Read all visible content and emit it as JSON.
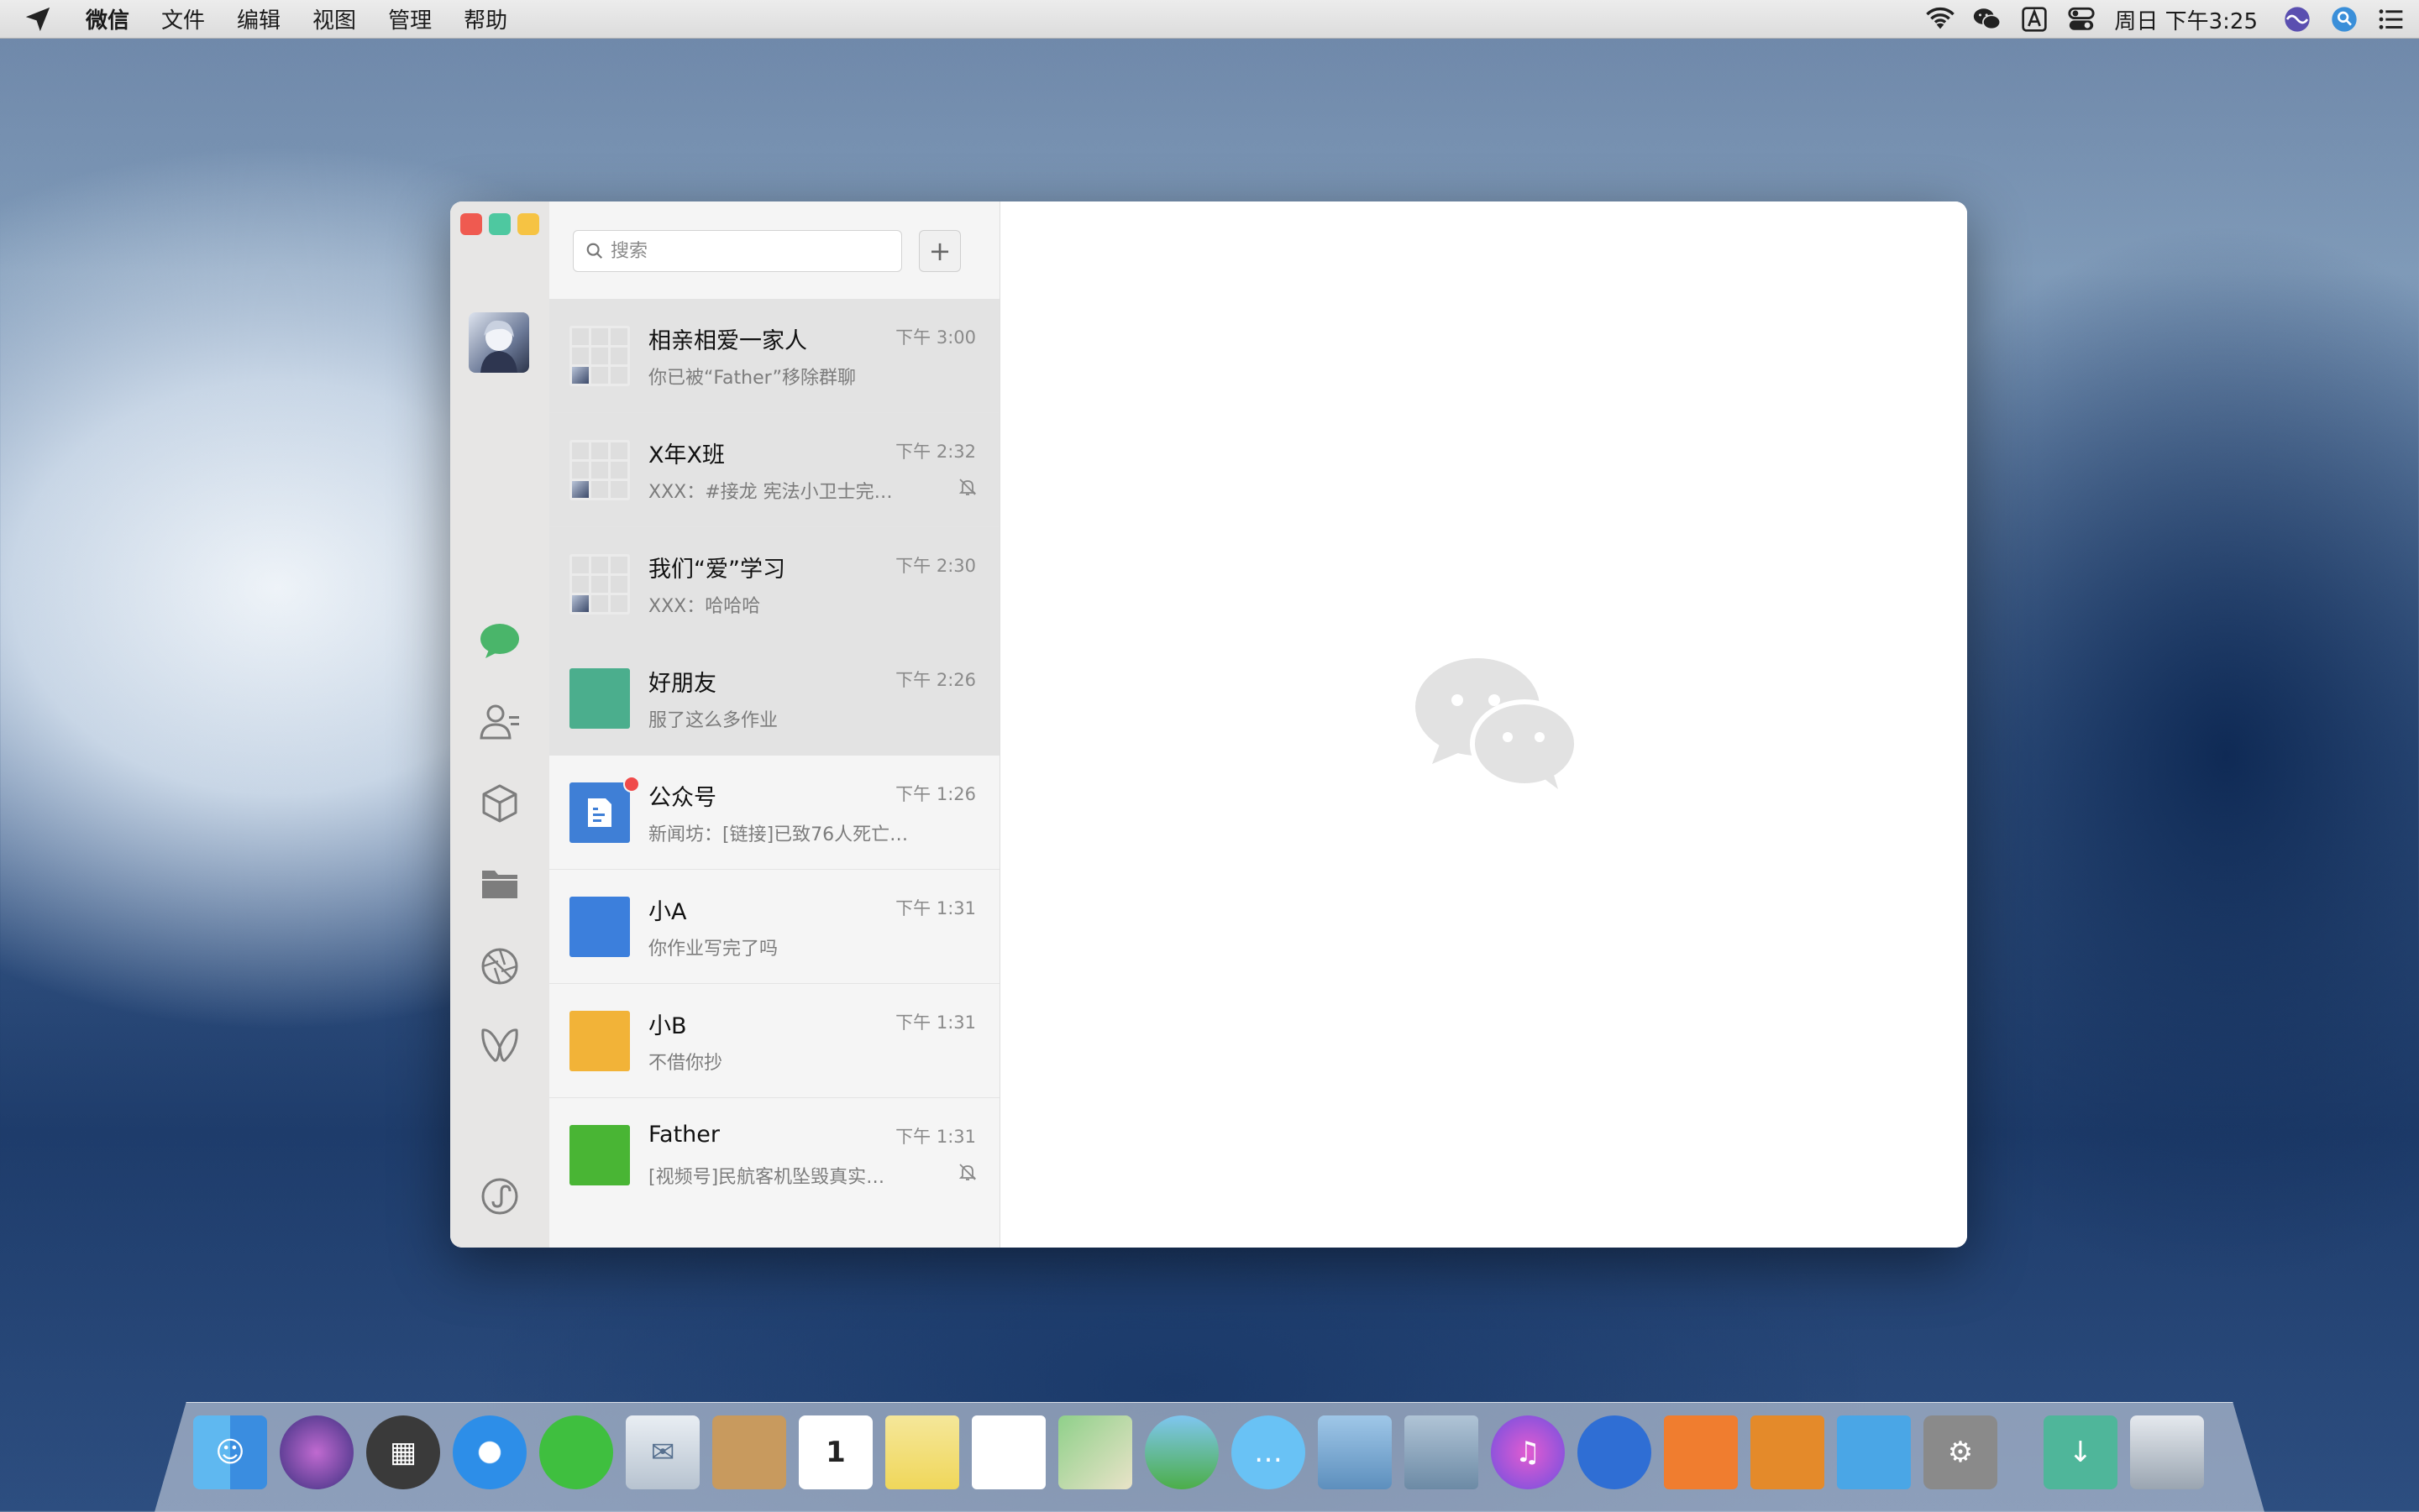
{
  "menubar": {
    "app_name": "微信",
    "menus": [
      "文件",
      "编辑",
      "视图",
      "管理",
      "帮助"
    ],
    "clock": "周日 下午3:25"
  },
  "window": {
    "search_placeholder": "搜索",
    "add_label": "+",
    "chats": [
      {
        "name": "相亲相爱一家人",
        "time": "下午 3:00",
        "message": "你已被“Father”移除群聊",
        "muted": false
      },
      {
        "name": "X年X班",
        "time": "下午 2:32",
        "message": "XXX：#接龙 宪法小卫士完成情...",
        "muted": true
      },
      {
        "name": "我们“爱”学习",
        "time": "下午 2:30",
        "message": "XXX：哈哈哈",
        "muted": false
      },
      {
        "name": "好朋友",
        "time": "下午 2:26",
        "message": "服了这么多作业",
        "muted": false
      },
      {
        "name": "公众号",
        "time": "下午 1:26",
        "message": "新闻坊：[链接]已致76人死亡，...",
        "muted": false
      },
      {
        "name": "小A",
        "time": "下午 1:31",
        "message": "你作业写完了吗",
        "muted": false
      },
      {
        "name": "小B",
        "time": "下午 1:31",
        "message": "不借你抄",
        "muted": false
      },
      {
        "name": "Father",
        "time": "下午 1:31",
        "message": "[视频号]民航客机坠毁真实影...",
        "muted": true
      }
    ]
  },
  "colors": {
    "wechat_green": "#4ab56a",
    "friends_thumb": "#4bae8d",
    "official_thumb": "#3f7fd6",
    "xiaoa_thumb": "#3c7fdc",
    "xiaob_thumb": "#f2b338",
    "father_thumb": "#49b534"
  }
}
